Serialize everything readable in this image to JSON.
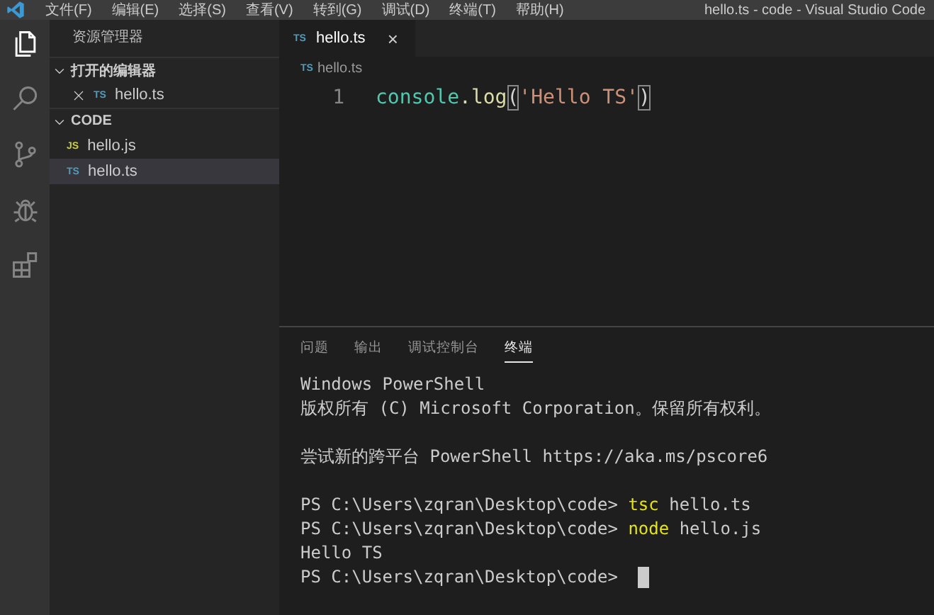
{
  "title_bar": {
    "menus": [
      "文件(F)",
      "编辑(E)",
      "选择(S)",
      "查看(V)",
      "转到(G)",
      "调试(D)",
      "终端(T)",
      "帮助(H)"
    ],
    "title": "hello.ts - code - Visual Studio Code"
  },
  "activity_bar": [
    {
      "kind": "files",
      "selected": true
    },
    {
      "kind": "search",
      "selected": false
    },
    {
      "kind": "source-control",
      "selected": false
    },
    {
      "kind": "debug",
      "selected": false
    },
    {
      "kind": "extensions",
      "selected": false
    }
  ],
  "sidebar": {
    "title": "资源管理器",
    "sections": [
      {
        "label": "打开的编辑器",
        "expanded": true,
        "items": [
          {
            "badge": "TS",
            "name": "hello.ts",
            "closable": true,
            "selected": false
          }
        ]
      },
      {
        "label": "CODE",
        "expanded": true,
        "items": [
          {
            "badge": "JS",
            "name": "hello.js",
            "closable": false,
            "selected": false
          },
          {
            "badge": "TS",
            "name": "hello.ts",
            "closable": false,
            "selected": true
          }
        ]
      }
    ]
  },
  "editor": {
    "tabs": [
      {
        "badge": "TS",
        "label": "hello.ts",
        "close": "×",
        "selected": true
      }
    ],
    "breadcrumb": {
      "badge": "TS",
      "label": "hello.ts"
    },
    "lines": [
      {
        "number": "1",
        "tokens": [
          {
            "text": "console",
            "kind": "type"
          },
          {
            "text": ".log",
            "kind": "function"
          },
          {
            "text": "(",
            "kind": "bracket"
          },
          {
            "text": "'Hello TS'",
            "kind": "string"
          },
          {
            "text": ")",
            "kind": "bracket"
          }
        ]
      }
    ]
  },
  "panel": {
    "tabs": [
      {
        "label": "问题",
        "selected": false
      },
      {
        "label": "输出",
        "selected": false
      },
      {
        "label": "调试控制台",
        "selected": false
      },
      {
        "label": "终端",
        "selected": true
      }
    ],
    "terminal": [
      {
        "lines": [
          {
            "text": "Windows PowerShell"
          },
          {
            "text": "版权所有 (C) Microsoft Corporation。保留所有权利。"
          }
        ]
      },
      {
        "lines": [
          {
            "text": "尝试新的跨平台 PowerShell https://aka.ms/pscore6"
          }
        ]
      },
      {
        "lines": [
          {
            "prompt": "PS C:\\Users\\zqran\\Desktop\\code>",
            "command": "tsc",
            "args": "hello.ts"
          },
          {
            "prompt": "PS C:\\Users\\zqran\\Desktop\\code>",
            "command": "node",
            "args": "hello.js"
          },
          {
            "text": "Hello TS"
          },
          {
            "prompt": "PS C:\\Users\\zqran\\Desktop\\code>",
            "cursor": true
          }
        ]
      }
    ]
  }
}
